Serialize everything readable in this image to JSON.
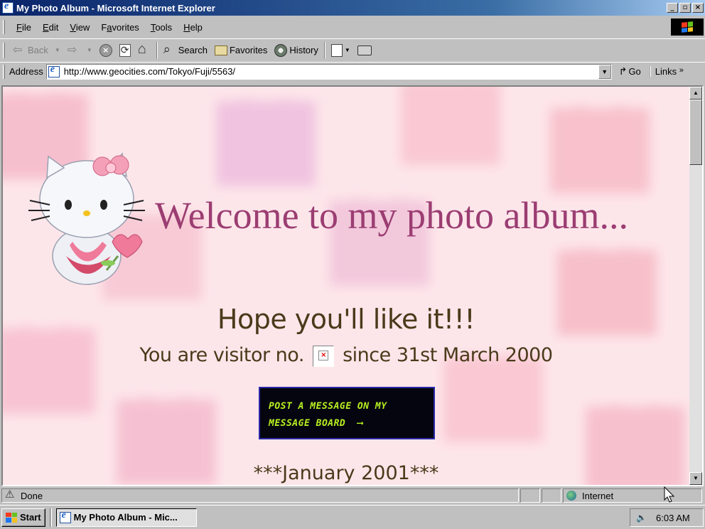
{
  "window": {
    "title": "My Photo Album - Microsoft Internet Explorer",
    "buttons": {
      "minimize": "_",
      "maximize": "▫",
      "close": "×"
    }
  },
  "menu": [
    {
      "pre": "",
      "key": "F",
      "post": "ile"
    },
    {
      "pre": "",
      "key": "E",
      "post": "dit"
    },
    {
      "pre": "",
      "key": "V",
      "post": "iew"
    },
    {
      "pre": "F",
      "key": "a",
      "post": "vorites"
    },
    {
      "pre": "",
      "key": "T",
      "post": "ools"
    },
    {
      "pre": "",
      "key": "H",
      "post": "elp"
    }
  ],
  "toolbar": {
    "back": "Back",
    "search": "Search",
    "favorites": "Favorites",
    "history": "History"
  },
  "address": {
    "label": "Address",
    "url": "http://www.geocities.com/Tokyo/Fuji/5563/",
    "go": "Go",
    "links": "Links"
  },
  "page": {
    "welcome": "Welcome to my photo album...",
    "hope": "Hope you'll like it!!!",
    "visitor_prefix": "You are visitor no.",
    "visitor_suffix": "since 31st March 2000",
    "message_board": [
      "POST A MESSAGE ON MY",
      "MESSAGE BOARD"
    ],
    "january": "***January 2001***"
  },
  "status": {
    "text": "Done",
    "zone": "Internet"
  },
  "taskbar": {
    "start": "Start",
    "task": "My Photo Album - Mic...",
    "time": "6:03 AM"
  },
  "colors": {
    "titlebar": "#0a246a",
    "page_bg": "#fde6ea",
    "welcome_text": "#9b3d72",
    "body_text": "#4a3a1a",
    "board_text": "#b8f020"
  }
}
